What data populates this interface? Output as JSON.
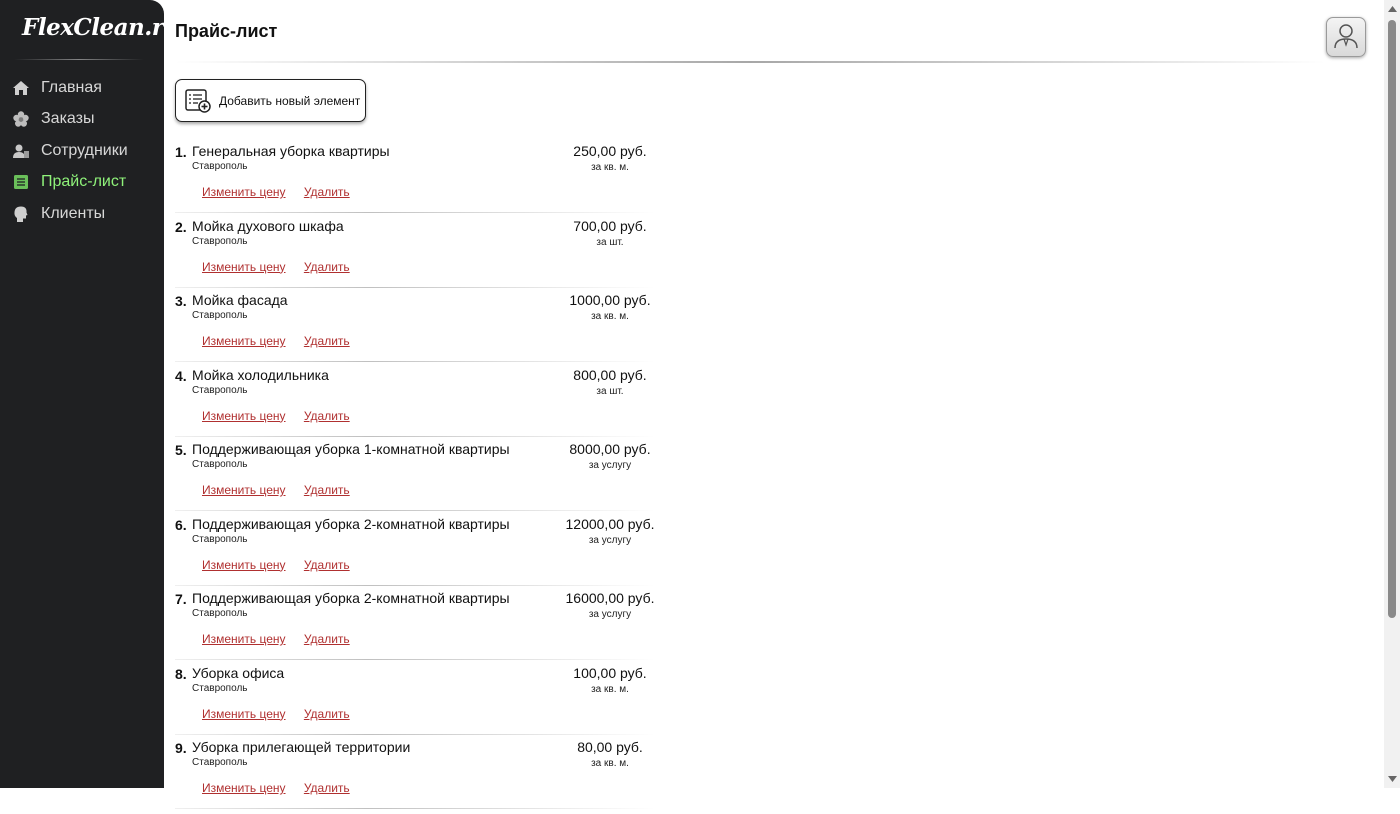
{
  "sidebar": {
    "logo": "FlexClean.ru",
    "items": [
      {
        "label": "Главная",
        "icon": "home-icon"
      },
      {
        "label": "Заказы",
        "icon": "flower-icon"
      },
      {
        "label": "Сотрудники",
        "icon": "staff-icon"
      },
      {
        "label": "Прайс-лист",
        "icon": "price-list-icon",
        "active": true
      },
      {
        "label": "Клиенты",
        "icon": "client-head-icon"
      }
    ]
  },
  "header": {
    "title": "Прайс-лист",
    "avatar_icon": "user-avatar-icon"
  },
  "toolbar": {
    "add_label": "Добавить новый элемент",
    "add_icon": "add-list-icon"
  },
  "actions": {
    "change_price": "Изменить цену",
    "delete": "Удалить"
  },
  "price_list": [
    {
      "num": "1.",
      "name": "Генеральная уборка квартиры",
      "city": "Ставрополь",
      "price": "250,00 руб.",
      "unit": "за кв. м."
    },
    {
      "num": "2.",
      "name": "Мойка духового шкафа",
      "city": "Ставрополь",
      "price": "700,00 руб.",
      "unit": "за шт."
    },
    {
      "num": "3.",
      "name": "Мойка фасада",
      "city": "Ставрополь",
      "price": "1000,00 руб.",
      "unit": "за кв. м."
    },
    {
      "num": "4.",
      "name": "Мойка холодильника",
      "city": "Ставрополь",
      "price": "800,00 руб.",
      "unit": "за шт."
    },
    {
      "num": "5.",
      "name": "Поддерживающая уборка 1-комнатной квартиры",
      "city": "Ставрополь",
      "price": "8000,00 руб.",
      "unit": "за услугу"
    },
    {
      "num": "6.",
      "name": "Поддерживающая уборка 2-комнатной квартиры",
      "city": "Ставрополь",
      "price": "12000,00 руб.",
      "unit": "за услугу"
    },
    {
      "num": "7.",
      "name": "Поддерживающая уборка 2-комнатной квартиры",
      "city": "Ставрополь",
      "price": "16000,00 руб.",
      "unit": "за услугу"
    },
    {
      "num": "8.",
      "name": "Уборка офиса",
      "city": "Ставрополь",
      "price": "100,00 руб.",
      "unit": "за кв. м."
    },
    {
      "num": "9.",
      "name": "Уборка прилегающей территории",
      "city": "Ставрополь",
      "price": "80,00 руб.",
      "unit": "за кв. м."
    }
  ],
  "colors": {
    "sidebar_bg": "#1f2022",
    "active_nav": "#8ff27a",
    "link": "#b03030"
  }
}
